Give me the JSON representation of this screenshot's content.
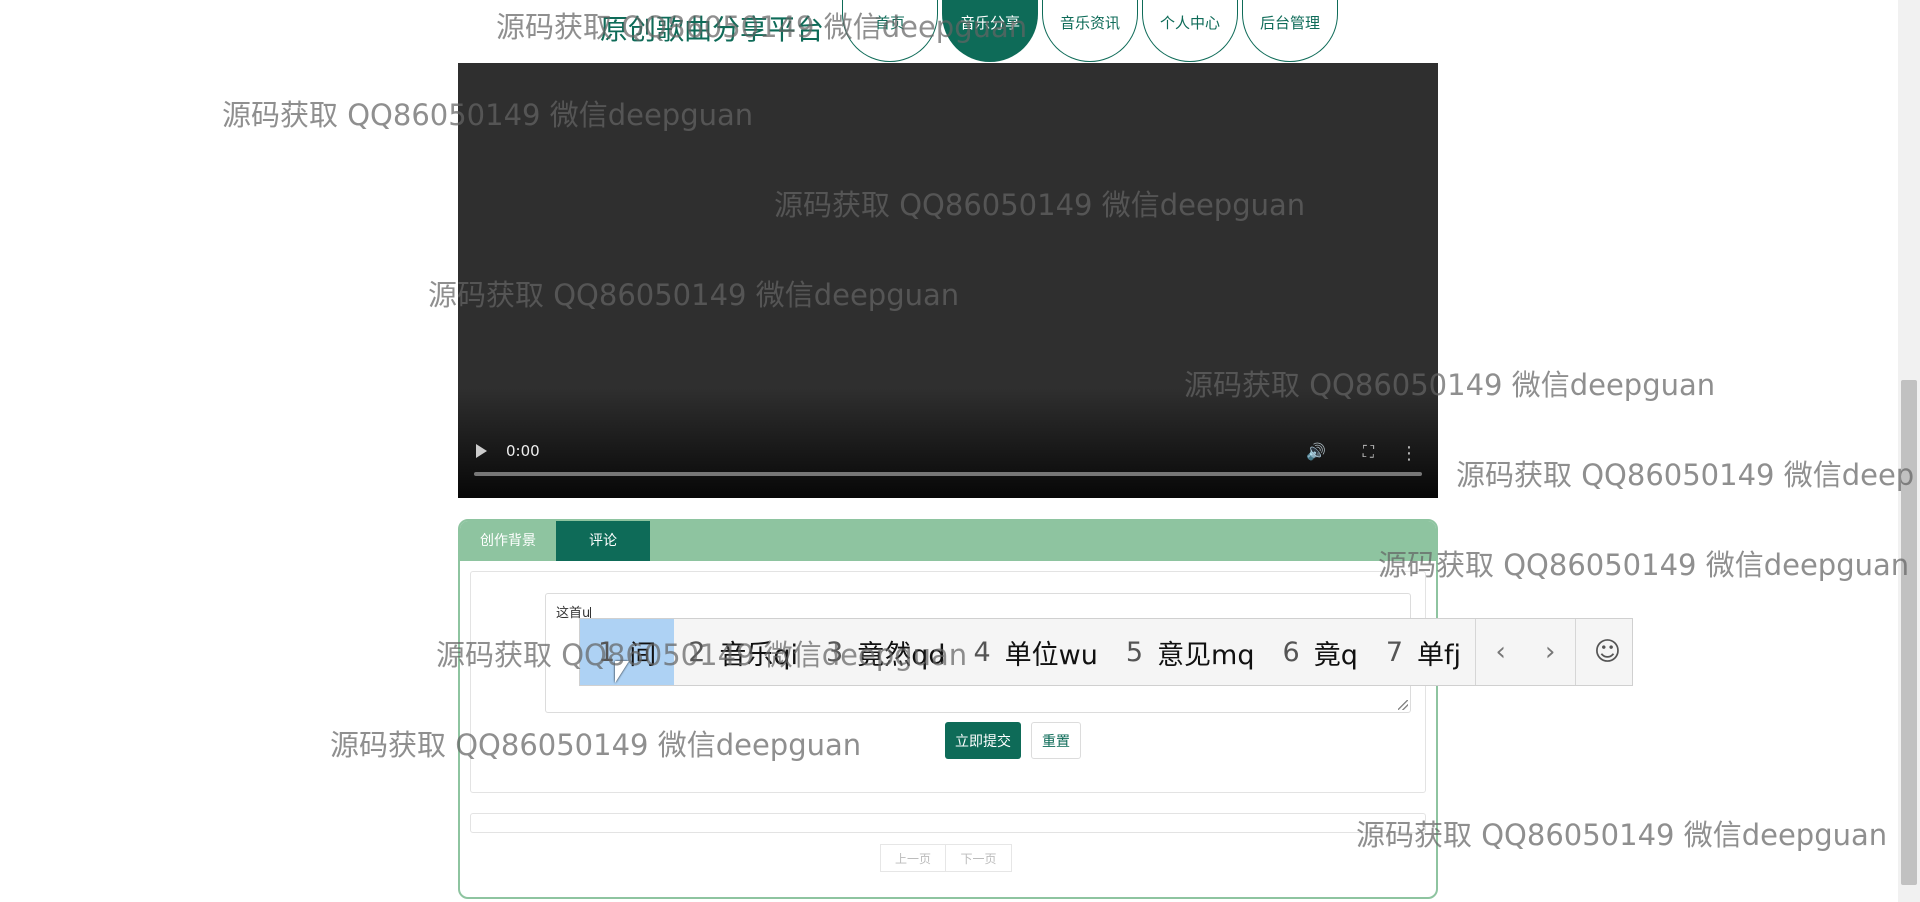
{
  "site": {
    "title": "原创歌曲分享平台"
  },
  "nav": {
    "items": [
      {
        "label": "首页"
      },
      {
        "label": "音乐分享"
      },
      {
        "label": "音乐资讯"
      },
      {
        "label": "个人中心"
      },
      {
        "label": "后台管理"
      }
    ],
    "active": "音乐分享"
  },
  "video": {
    "time": "0:00",
    "progress": 0
  },
  "tabs": [
    {
      "label": "创作背景"
    },
    {
      "label": "评论"
    }
  ],
  "active_tab": "评论",
  "comment_form": {
    "input_text": "这首u",
    "submit_label": "立即提交",
    "reset_label": "重置"
  },
  "pagination": {
    "prev_label": "上一页",
    "next_label": "下一页"
  },
  "ime": {
    "candidates": [
      {
        "num": "1",
        "text": "间"
      },
      {
        "num": "2",
        "text": "音乐qi"
      },
      {
        "num": "3",
        "text": "竟然qd"
      },
      {
        "num": "4",
        "text": "单位wu"
      },
      {
        "num": "5",
        "text": "意见mq"
      },
      {
        "num": "6",
        "text": "竟q"
      },
      {
        "num": "7",
        "text": "单fj"
      }
    ],
    "selected_index": 0
  },
  "watermark": {
    "text": "源码获取 QQ86050149 微信deepguan",
    "partial_text": "源码获取 QQ86050149 微信deep"
  },
  "colors": {
    "primary": "#0e6b58",
    "tab_bar": "#8ec4a0",
    "ime_selected": "#aed2f4"
  }
}
